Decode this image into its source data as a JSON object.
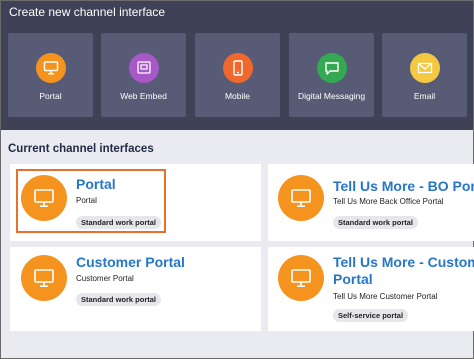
{
  "create": {
    "title": "Create new channel interface",
    "tiles": [
      {
        "label": "Portal",
        "icon": "monitor-icon",
        "color": "#f4941f"
      },
      {
        "label": "Web Embed",
        "icon": "web-embed-icon",
        "color": "#a658c7"
      },
      {
        "label": "Mobile",
        "icon": "mobile-icon",
        "color": "#f0682b"
      },
      {
        "label": "Digital Messaging",
        "icon": "chat-bubble-icon",
        "color": "#34a853"
      },
      {
        "label": "Email",
        "icon": "envelope-icon",
        "color": "#f5c842"
      }
    ]
  },
  "current": {
    "title": "Current channel interfaces",
    "cards": [
      {
        "title": "Portal",
        "subtitle": "Portal",
        "badge": "Standard work portal",
        "icon": "monitor-icon"
      },
      {
        "title": "Tell Us More - BO Porta",
        "subtitle": "Tell Us More Back Office Portal",
        "badge": "Standard work portal",
        "icon": "monitor-icon"
      },
      {
        "title": "Customer Portal",
        "subtitle": "Customer Portal",
        "badge": "Standard work portal",
        "icon": "monitor-icon"
      },
      {
        "title_line1": "Tell Us More - Custome",
        "title_line2": "Portal",
        "subtitle": "Tell Us More Customer Portal",
        "badge": "Self-service portal",
        "icon": "monitor-icon"
      }
    ]
  },
  "colors": {
    "accent": "#f4941f",
    "link": "#2677c9",
    "highlight": "#e8702a"
  }
}
